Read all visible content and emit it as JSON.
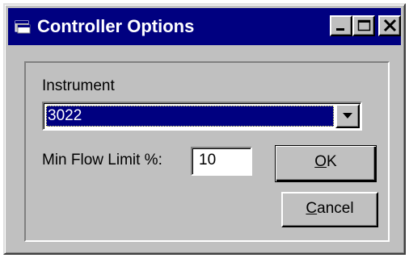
{
  "window": {
    "title": "Controller Options",
    "title_icon": "app-window-icon",
    "titlebar_color": "#000080",
    "face_color": "#c0c0c0"
  },
  "titlebar_buttons": {
    "minimize_icon": "minimize-icon",
    "maximize_icon": "maximize-icon",
    "close_icon": "close-icon"
  },
  "form": {
    "instrument_label": "Instrument",
    "instrument_selected": "3022",
    "dropdown_icon": "chevron-down-icon",
    "min_flow_label": "Min Flow Limit %:",
    "min_flow_value": "10"
  },
  "buttons": {
    "ok_mnemonic": "O",
    "ok_rest": "K",
    "cancel_mnemonic": "C",
    "cancel_rest": "ancel"
  }
}
